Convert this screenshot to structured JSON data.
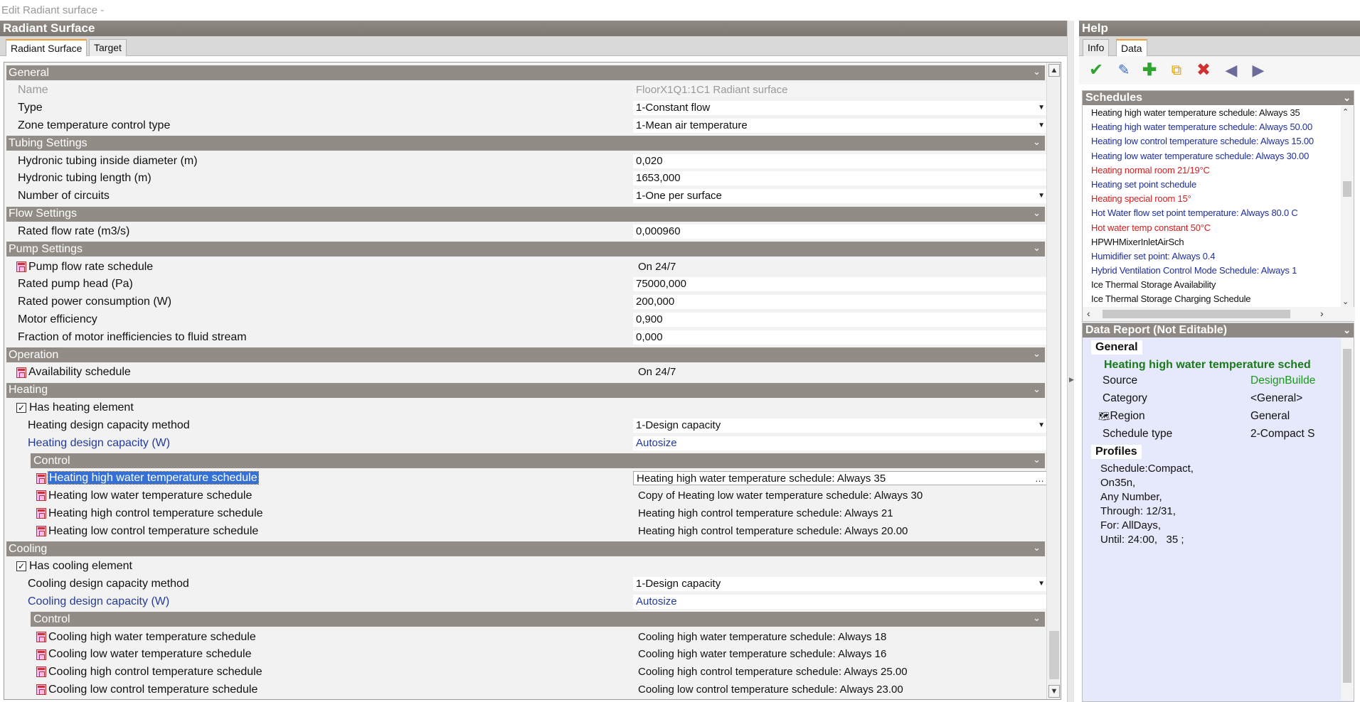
{
  "window": {
    "title": "Edit Radiant surface -"
  },
  "left": {
    "header": "Radiant Surface",
    "tabs": [
      "Radiant Surface",
      "Target"
    ],
    "sections": {
      "general": "General",
      "tubing": "Tubing Settings",
      "flow": "Flow Settings",
      "pump": "Pump Settings",
      "operation": "Operation",
      "heating": "Heating",
      "heating_control": "Control",
      "cooling": "Cooling",
      "cooling_control": "Control"
    },
    "fields": {
      "name": {
        "label": "Name",
        "value": "FloorX1Q1:1C1 Radiant surface"
      },
      "type": {
        "label": "Type",
        "value": "1-Constant flow"
      },
      "zone_temp": {
        "label": "Zone temperature control type",
        "value": "1-Mean air temperature"
      },
      "tube_diam": {
        "label": "Hydronic tubing inside diameter (m)",
        "value": "0,020"
      },
      "tube_len": {
        "label": "Hydronic tubing length (m)",
        "value": "1653,000"
      },
      "circuits": {
        "label": "Number of circuits",
        "value": "1-One per surface"
      },
      "flow_rate": {
        "label": "Rated flow rate (m3/s)",
        "value": "0,000960"
      },
      "pump_sched": {
        "label": "Pump flow rate schedule",
        "value": "On 24/7"
      },
      "pump_head": {
        "label": "Rated pump head (Pa)",
        "value": "75000,000"
      },
      "power": {
        "label": "Rated power consumption (W)",
        "value": "200,000"
      },
      "motor_eff": {
        "label": "Motor efficiency",
        "value": "0,900"
      },
      "frac_motor": {
        "label": "Fraction of motor inefficiencies to fluid stream",
        "value": "0,000"
      },
      "avail": {
        "label": "Availability schedule",
        "value": "On 24/7"
      },
      "has_heating": {
        "label": "Has heating element",
        "checked": "✓"
      },
      "heat_method": {
        "label": "Heating design capacity method",
        "value": "1-Design capacity"
      },
      "heat_cap": {
        "label": "Heating design capacity (W)",
        "value": "Autosize"
      },
      "heat_hw": {
        "label": "Heating high water temperature schedule",
        "value": "Heating high water temperature schedule: Always 35"
      },
      "heat_lw": {
        "label": "Heating low water temperature schedule",
        "value": "Copy of Heating low water temperature schedule: Always 30"
      },
      "heat_hc": {
        "label": "Heating high control temperature schedule",
        "value": "Heating high control temperature schedule: Always 21"
      },
      "heat_lc": {
        "label": "Heating low control temperature schedule",
        "value": "Heating high control temperature schedule: Always 20.00"
      },
      "has_cooling": {
        "label": "Has cooling element",
        "checked": "✓"
      },
      "cool_method": {
        "label": "Cooling design capacity method",
        "value": "1-Design capacity"
      },
      "cool_cap": {
        "label": "Cooling design capacity (W)",
        "value": "Autosize"
      },
      "cool_hw": {
        "label": "Cooling high water temperature schedule",
        "value": "Cooling high water temperature schedule: Always 18"
      },
      "cool_lw": {
        "label": "Cooling low water temperature schedule",
        "value": "Cooling high water temperature schedule: Always 16"
      },
      "cool_hc": {
        "label": "Cooling high control temperature schedule",
        "value": "Cooling high control temperature schedule: Always 25.00"
      },
      "cool_lc": {
        "label": "Cooling low control temperature schedule",
        "value": "Cooling low control temperature schedule: Always 23.00"
      }
    }
  },
  "right": {
    "header": "Help",
    "tabs": [
      "Info",
      "Data"
    ],
    "schedules_title": "Schedules",
    "schedules": [
      {
        "text": "Heating high water temperature schedule: Always 35",
        "color": "black"
      },
      {
        "text": "Heating high water temperature schedule: Always 50.00",
        "color": "blue"
      },
      {
        "text": "Heating low control temperature schedule: Always 15.00",
        "color": "blue"
      },
      {
        "text": "Heating low water temperature schedule: Always 30.00",
        "color": "blue"
      },
      {
        "text": "Heating normal room 21/19°C",
        "color": "red"
      },
      {
        "text": "Heating set point schedule",
        "color": "blue"
      },
      {
        "text": "Heating special room 15°",
        "color": "red"
      },
      {
        "text": "Hot Water flow set point temperature: Always 80.0 C",
        "color": "blue"
      },
      {
        "text": "Hot water temp constant 50°C",
        "color": "red"
      },
      {
        "text": "HPWHMixerInletAirSch",
        "color": "black"
      },
      {
        "text": "Humidifier set point: Always 0.4",
        "color": "blue"
      },
      {
        "text": "Hybrid Ventilation Control Mode Schedule: Always 1",
        "color": "blue"
      },
      {
        "text": "Ice Thermal Storage Availability",
        "color": "black"
      },
      {
        "text": "Ice Thermal Storage Charging Schedule",
        "color": "black"
      }
    ],
    "report_title": "Data Report (Not Editable)",
    "report": {
      "general_head": "General",
      "item_title": "Heating high water temperature sched",
      "rows": [
        {
          "k": "Source",
          "v": "DesignBuilde"
        },
        {
          "k": "Category",
          "v": "<General>"
        },
        {
          "k": "Region",
          "v": "General"
        },
        {
          "k": "Schedule type",
          "v": "2-Compact S"
        }
      ],
      "profiles_head": "Profiles",
      "profile_lines": [
        "Schedule:Compact,",
        "On35n,",
        "Any Number,",
        "Through: 12/31,",
        "For: AllDays,",
        "Until: 24:00,   35 ;"
      ]
    }
  }
}
